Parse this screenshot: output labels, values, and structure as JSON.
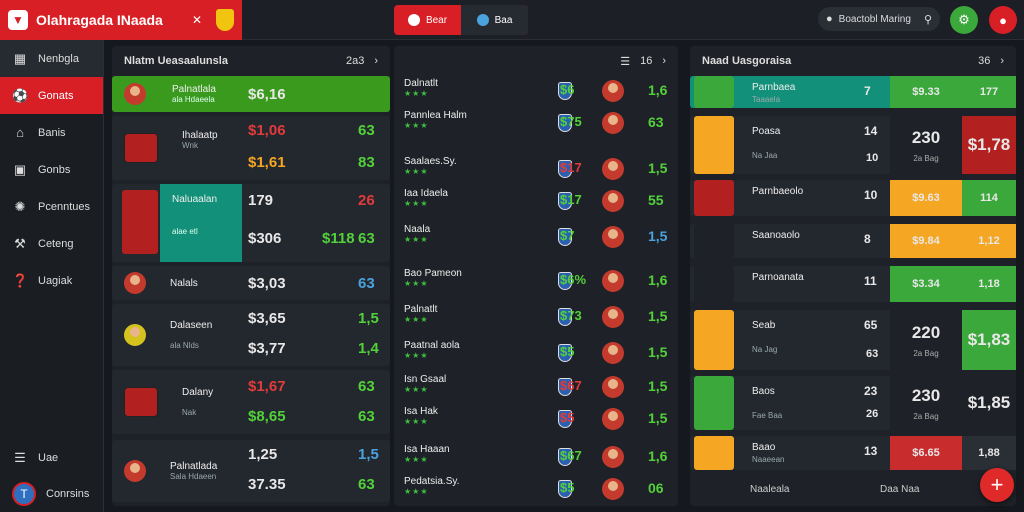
{
  "topbar": {
    "brand": "Olahragada INaada",
    "tabs": [
      {
        "label": "Bear"
      },
      {
        "label": "Baa"
      }
    ],
    "search_placeholder": "Boactobl Maring"
  },
  "sidebar": {
    "items": [
      {
        "label": "Nenbgla",
        "icon": "grid-icon"
      },
      {
        "label": "Gonats",
        "icon": "ball-icon"
      },
      {
        "label": "Banis",
        "icon": "home-icon"
      },
      {
        "label": "Gonbs",
        "icon": "calendar-icon"
      },
      {
        "label": "Pcenntues",
        "icon": "football-icon"
      },
      {
        "label": "Ceteng",
        "icon": "tool-icon"
      },
      {
        "label": "Uagiak",
        "icon": "help-icon"
      }
    ],
    "footer": [
      {
        "label": "Uae",
        "icon": "chat-icon"
      },
      {
        "label": "Conrsins",
        "icon": "user-avatar"
      }
    ]
  },
  "panel_left": {
    "title": "Nlatm Ueasaalunsla",
    "head_value": "2a3",
    "rows": [
      {
        "name": "Palnatlala",
        "sub": "ala Hdaeela",
        "price": "$6,16"
      },
      {
        "name": "Ihalaatp",
        "sub": "Wnk",
        "price1": "$1,06",
        "val1": "63",
        "price2": "$1,61",
        "val2": "83"
      },
      {
        "name": "Naluaalan",
        "sub": "alae etl",
        "p1": "179",
        "v1": "26",
        "p2": "$306",
        "m2": "$118",
        "v2": "63"
      },
      {
        "name": "Nalals",
        "price": "$3,03",
        "val": "63"
      },
      {
        "name": "Dalaseen",
        "sub": "ala Nlds",
        "p1": "$3,65",
        "v1": "1,5",
        "p2": "$3,77",
        "v2": "1,4"
      },
      {
        "name": "Dalany",
        "sub": "Nak",
        "p1": "$1,67",
        "v1": "63",
        "p2": "$8,65",
        "v2": "63"
      },
      {
        "name": "Palnatlada",
        "sub": "Sala Hdaeen",
        "p1": "1,25",
        "v1": "1,5",
        "p2": "37.35",
        "v2": "63"
      }
    ]
  },
  "panel_mid": {
    "head_value": "16",
    "rows": [
      {
        "name": "Dalnatlt",
        "val": "$6",
        "score": "1,6"
      },
      {
        "name": "Pannlea Halm",
        "val": "$75",
        "score": "63"
      },
      {
        "name": "Saalaes.Sy.",
        "val": "$17",
        "score": "1,5"
      },
      {
        "name": "Iaa Idaela",
        "val": "$17",
        "score": "55"
      },
      {
        "name": "Naala",
        "val": "$7",
        "score": "1,5"
      },
      {
        "name": "Bao Pameon",
        "val": "$6%",
        "score": "1,6"
      },
      {
        "name": "Palnatlt",
        "val": "$73",
        "score": "1,5"
      },
      {
        "name": "Paatnal aola",
        "val": "$5",
        "score": "1,5"
      },
      {
        "name": "Isn Gsaal",
        "val": "$67",
        "score": "1,5"
      },
      {
        "name": "Isa Hak",
        "val": "$5",
        "score": "1,5"
      },
      {
        "name": "Isa Haaan",
        "val": "$67",
        "score": "1,6"
      },
      {
        "name": "Pedatsia.Sy.",
        "val": "$5",
        "score": "06"
      }
    ]
  },
  "panel_right": {
    "title": "Naad Uasgoraisa",
    "head_value": "36",
    "rows": [
      {
        "name": "Parnbaea",
        "sub": "Taaaela",
        "n": "7",
        "b1": "$9.33",
        "b2": "177"
      },
      {
        "name": "Poasa",
        "sub": "Na Jaa",
        "n": "14",
        "n2": "10",
        "b1": "230",
        "b1sub": "2a Bag",
        "b2": "$1,78"
      },
      {
        "name": "Parnbaeolo",
        "n": "10",
        "b1": "$9.63",
        "b2": "114"
      },
      {
        "name": "Saanoaolo",
        "n": "8",
        "b1": "$9.84",
        "b2": "1,12"
      },
      {
        "name": "Parnoanata",
        "n": "11",
        "b1": "$3.34",
        "b2": "1,18"
      },
      {
        "name": "Seab",
        "sub": "Na Jag",
        "n": "65",
        "n2": "63",
        "b1": "220",
        "b1sub": "2a Bag",
        "b2": "$1,83"
      },
      {
        "name": "Baos",
        "sub": "Fae Baa",
        "n": "23",
        "n2": "26",
        "b1": "230",
        "b1sub": "2a Bag",
        "b2": "$1,85"
      },
      {
        "name": "Baao",
        "sub": "Naaeean",
        "n": "13",
        "b1": "$6.65",
        "b2": "1,88"
      }
    ],
    "footer_left": "Naaleala",
    "footer_right": "Daa Naa"
  },
  "colors": {
    "accent": "#d81f26",
    "green": "#53d13a",
    "orange": "#f5a623",
    "red": "#c82c2c",
    "blue": "#4aa3df"
  }
}
